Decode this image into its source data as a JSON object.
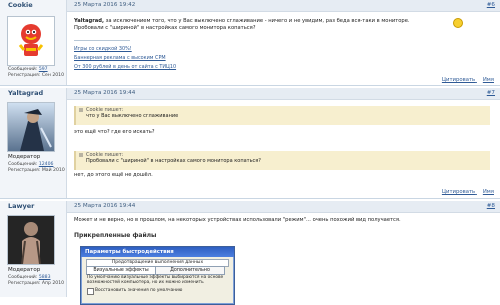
{
  "posts": [
    {
      "author": "Cookie",
      "date": "25 Марта 2016 19:42",
      "number": "#6",
      "messages_label": "Сообщений:",
      "messages_count": "597",
      "registration_label": "Регистрация:",
      "registration_date": "Сен 2010",
      "content": {
        "prefix": "Yaltagrad,",
        "line1": "за исключением того, что у Вас выключено сглаживание - ничего и не увидим, раз беда вся-таки в мониторе.",
        "line2": "Пробовали с \"шириной\" в настройках самого монитора копаться?"
      },
      "links": [
        "Игры со скидкой 30%!",
        "Баннерная реклама с высоким CPM",
        "От 300 рублей в день от сайта с ТИЦ10"
      ],
      "actions": [
        "Цитировать",
        "Имя"
      ]
    },
    {
      "author": "Yaltagrad",
      "date": "25 Марта 2016 19:44",
      "number": "#7",
      "role": "Модератор",
      "messages_label": "Сообщений:",
      "messages_count": "12406",
      "registration_label": "Регистрация:",
      "registration_date": "Май 2010",
      "quote1": {
        "attribution": "Cookie пишет:",
        "text": "что у Вас выключено сглаживание"
      },
      "reply1": "это ещё что? где его искать?",
      "quote2": {
        "attribution": "Cookie пишет:",
        "text": "Пробовали с \"шириной\" в настройках самого монитора копаться?"
      },
      "reply2": "нет, до этого ещё не дошёл.",
      "actions": [
        "Цитировать",
        "Имя"
      ]
    },
    {
      "author": "Lawyer",
      "date": "25 Марта 2016 19:44",
      "number": "#8",
      "role": "Модератор",
      "messages_label": "Сообщений:",
      "messages_count": "5883",
      "registration_label": "Регистрация:",
      "registration_date": "Апр 2010",
      "content": "Может и не верно, но в прошлом, на некоторых устройствах использовали \"режим\"... очень похожий вид получается.",
      "attachments_title": "Прикрепленные файлы",
      "dialog": {
        "title": "Параметры быстродействия",
        "top_tab": "Предотвращение выполнения данных",
        "tabs": [
          "Визуальные эффекты",
          "Дополнительно"
        ],
        "text": "По умолчанию визуальные эффекты выбираются на основе возможностей компьютера, но их можно изменить",
        "option": "Восстановить значения по умолчанию"
      }
    }
  ]
}
